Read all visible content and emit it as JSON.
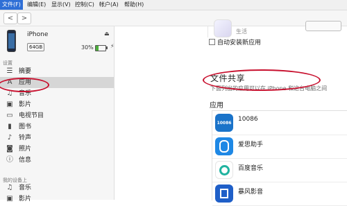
{
  "menu": {
    "items": [
      "文件(F)",
      "编辑(E)",
      "显示(V)",
      "控制(C)",
      "帐户(A)",
      "帮助(H)"
    ]
  },
  "toolbar": {
    "back_glyph": "<",
    "forward_glyph": ">"
  },
  "device": {
    "name": "iPhone",
    "capacity": "64GB",
    "battery_percent_text": "30%",
    "battery_level": 0.3,
    "eject_glyph": "⏏",
    "charging_glyph": "⚡"
  },
  "sidebar": {
    "settings_label": "设置",
    "settings_items": [
      {
        "label": "摘要",
        "icon": "summary-icon"
      },
      {
        "label": "应用",
        "icon": "apps-icon",
        "selected": true
      },
      {
        "label": "音乐",
        "icon": "music-note-icon"
      },
      {
        "label": "影片",
        "icon": "film-icon"
      },
      {
        "label": "电视节目",
        "icon": "tv-icon"
      },
      {
        "label": "图书",
        "icon": "book-icon"
      },
      {
        "label": "铃声",
        "icon": "bell-icon"
      },
      {
        "label": "照片",
        "icon": "camera-icon"
      },
      {
        "label": "信息",
        "icon": "info-icon"
      }
    ],
    "on_device_label": "我的设备上",
    "on_device_items": [
      {
        "label": "音乐",
        "icon": "music-note-icon"
      },
      {
        "label": "影片",
        "icon": "film-icon"
      }
    ]
  },
  "main": {
    "top_app_category": "生活",
    "auto_install_label": "自动安装新应用",
    "file_sharing": {
      "title": "文件共享",
      "description": "下面列出的应用可以在 iPhone 和这台电脑之间"
    },
    "apps_title": "应用",
    "apps": [
      {
        "name": "10086",
        "icon_text": "10086",
        "icon": "10086-icon"
      },
      {
        "name": "爱思助手",
        "icon": "aisi-icon"
      },
      {
        "name": "百度音乐",
        "icon": "baidu-music-icon"
      },
      {
        "name": "暴风影音",
        "icon": "baofeng-icon"
      }
    ]
  },
  "colors": {
    "annotation": "#c8102e",
    "menu_active": "#2f6fd6",
    "battery": "#4cae3b"
  }
}
